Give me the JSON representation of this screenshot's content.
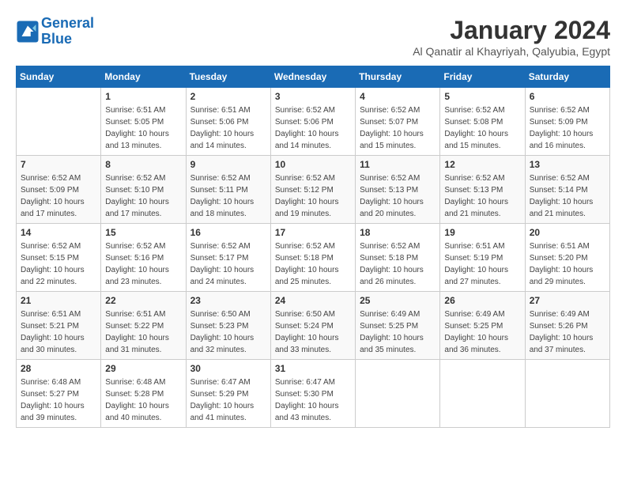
{
  "header": {
    "logo_line1": "General",
    "logo_line2": "Blue",
    "month_title": "January 2024",
    "location": "Al Qanatir al Khayriyah, Qalyubia, Egypt"
  },
  "weekdays": [
    "Sunday",
    "Monday",
    "Tuesday",
    "Wednesday",
    "Thursday",
    "Friday",
    "Saturday"
  ],
  "weeks": [
    [
      {
        "day": "",
        "info": ""
      },
      {
        "day": "1",
        "info": "Sunrise: 6:51 AM\nSunset: 5:05 PM\nDaylight: 10 hours\nand 13 minutes."
      },
      {
        "day": "2",
        "info": "Sunrise: 6:51 AM\nSunset: 5:06 PM\nDaylight: 10 hours\nand 14 minutes."
      },
      {
        "day": "3",
        "info": "Sunrise: 6:52 AM\nSunset: 5:06 PM\nDaylight: 10 hours\nand 14 minutes."
      },
      {
        "day": "4",
        "info": "Sunrise: 6:52 AM\nSunset: 5:07 PM\nDaylight: 10 hours\nand 15 minutes."
      },
      {
        "day": "5",
        "info": "Sunrise: 6:52 AM\nSunset: 5:08 PM\nDaylight: 10 hours\nand 15 minutes."
      },
      {
        "day": "6",
        "info": "Sunrise: 6:52 AM\nSunset: 5:09 PM\nDaylight: 10 hours\nand 16 minutes."
      }
    ],
    [
      {
        "day": "7",
        "info": "Sunrise: 6:52 AM\nSunset: 5:09 PM\nDaylight: 10 hours\nand 17 minutes."
      },
      {
        "day": "8",
        "info": "Sunrise: 6:52 AM\nSunset: 5:10 PM\nDaylight: 10 hours\nand 17 minutes."
      },
      {
        "day": "9",
        "info": "Sunrise: 6:52 AM\nSunset: 5:11 PM\nDaylight: 10 hours\nand 18 minutes."
      },
      {
        "day": "10",
        "info": "Sunrise: 6:52 AM\nSunset: 5:12 PM\nDaylight: 10 hours\nand 19 minutes."
      },
      {
        "day": "11",
        "info": "Sunrise: 6:52 AM\nSunset: 5:13 PM\nDaylight: 10 hours\nand 20 minutes."
      },
      {
        "day": "12",
        "info": "Sunrise: 6:52 AM\nSunset: 5:13 PM\nDaylight: 10 hours\nand 21 minutes."
      },
      {
        "day": "13",
        "info": "Sunrise: 6:52 AM\nSunset: 5:14 PM\nDaylight: 10 hours\nand 21 minutes."
      }
    ],
    [
      {
        "day": "14",
        "info": "Sunrise: 6:52 AM\nSunset: 5:15 PM\nDaylight: 10 hours\nand 22 minutes."
      },
      {
        "day": "15",
        "info": "Sunrise: 6:52 AM\nSunset: 5:16 PM\nDaylight: 10 hours\nand 23 minutes."
      },
      {
        "day": "16",
        "info": "Sunrise: 6:52 AM\nSunset: 5:17 PM\nDaylight: 10 hours\nand 24 minutes."
      },
      {
        "day": "17",
        "info": "Sunrise: 6:52 AM\nSunset: 5:18 PM\nDaylight: 10 hours\nand 25 minutes."
      },
      {
        "day": "18",
        "info": "Sunrise: 6:52 AM\nSunset: 5:18 PM\nDaylight: 10 hours\nand 26 minutes."
      },
      {
        "day": "19",
        "info": "Sunrise: 6:51 AM\nSunset: 5:19 PM\nDaylight: 10 hours\nand 27 minutes."
      },
      {
        "day": "20",
        "info": "Sunrise: 6:51 AM\nSunset: 5:20 PM\nDaylight: 10 hours\nand 29 minutes."
      }
    ],
    [
      {
        "day": "21",
        "info": "Sunrise: 6:51 AM\nSunset: 5:21 PM\nDaylight: 10 hours\nand 30 minutes."
      },
      {
        "day": "22",
        "info": "Sunrise: 6:51 AM\nSunset: 5:22 PM\nDaylight: 10 hours\nand 31 minutes."
      },
      {
        "day": "23",
        "info": "Sunrise: 6:50 AM\nSunset: 5:23 PM\nDaylight: 10 hours\nand 32 minutes."
      },
      {
        "day": "24",
        "info": "Sunrise: 6:50 AM\nSunset: 5:24 PM\nDaylight: 10 hours\nand 33 minutes."
      },
      {
        "day": "25",
        "info": "Sunrise: 6:49 AM\nSunset: 5:25 PM\nDaylight: 10 hours\nand 35 minutes."
      },
      {
        "day": "26",
        "info": "Sunrise: 6:49 AM\nSunset: 5:25 PM\nDaylight: 10 hours\nand 36 minutes."
      },
      {
        "day": "27",
        "info": "Sunrise: 6:49 AM\nSunset: 5:26 PM\nDaylight: 10 hours\nand 37 minutes."
      }
    ],
    [
      {
        "day": "28",
        "info": "Sunrise: 6:48 AM\nSunset: 5:27 PM\nDaylight: 10 hours\nand 39 minutes."
      },
      {
        "day": "29",
        "info": "Sunrise: 6:48 AM\nSunset: 5:28 PM\nDaylight: 10 hours\nand 40 minutes."
      },
      {
        "day": "30",
        "info": "Sunrise: 6:47 AM\nSunset: 5:29 PM\nDaylight: 10 hours\nand 41 minutes."
      },
      {
        "day": "31",
        "info": "Sunrise: 6:47 AM\nSunset: 5:30 PM\nDaylight: 10 hours\nand 43 minutes."
      },
      {
        "day": "",
        "info": ""
      },
      {
        "day": "",
        "info": ""
      },
      {
        "day": "",
        "info": ""
      }
    ]
  ]
}
